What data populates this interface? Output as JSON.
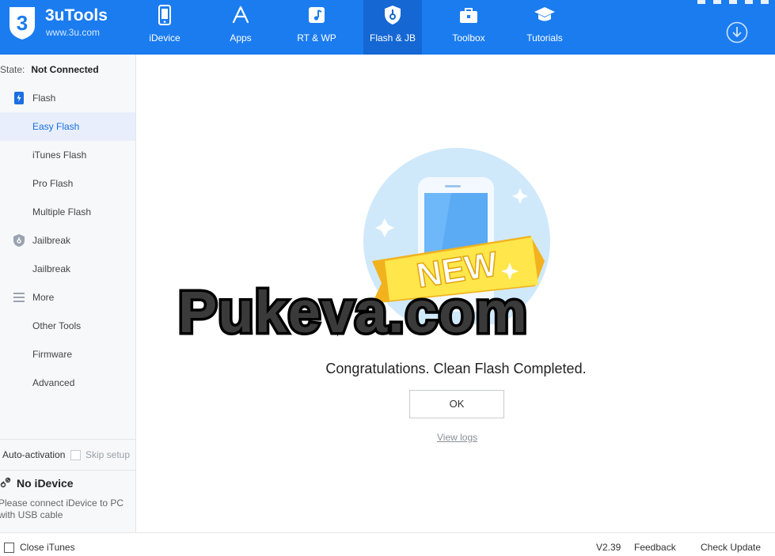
{
  "app": {
    "name": "3uTools",
    "site": "www.3u.com",
    "brand_color": "#1b7cf0",
    "logo_icon": "3u-logo-icon"
  },
  "nav": {
    "tabs": [
      {
        "label": "iDevice",
        "icon": "phone-icon"
      },
      {
        "label": "Apps",
        "icon": "app-store-icon"
      },
      {
        "label": "RT & WP",
        "icon": "music-note-icon"
      },
      {
        "label": "Flash & JB",
        "icon": "shield-key-icon",
        "active": true
      },
      {
        "label": "Toolbox",
        "icon": "toolbox-icon"
      },
      {
        "label": "Tutorials",
        "icon": "graduation-cap-icon"
      }
    ],
    "download_icon": "download-icon"
  },
  "sidebar": {
    "state_label": "State:",
    "state_value": "Not Connected",
    "groups": [
      {
        "label": "Flash",
        "icon": "flash-phone-icon",
        "items": [
          "Easy Flash",
          "iTunes Flash",
          "Pro Flash",
          "Multiple Flash"
        ]
      },
      {
        "label": "Jailbreak",
        "icon": "shield-icon",
        "items": [
          "Jailbreak"
        ]
      },
      {
        "label": "More",
        "icon": "menu-lines-icon",
        "items": [
          "Other Tools",
          "Firmware",
          "Advanced"
        ]
      }
    ],
    "selected_item": "Easy Flash",
    "auto_activation": "Auto-activation",
    "skip_setup": "Skip setup",
    "no_idevice_title": "No iDevice",
    "connect_msg": "Please connect iDevice to PC with USB cable"
  },
  "main": {
    "illustration_banner": "NEW",
    "watermark": "Pukeva.com",
    "message": "Congratulations. Clean Flash Completed.",
    "ok_label": "OK",
    "view_logs": "View logs"
  },
  "footer": {
    "close_itunes": "Close iTunes",
    "version": "V2.39",
    "feedback": "Feedback",
    "check_update": "Check Update"
  }
}
